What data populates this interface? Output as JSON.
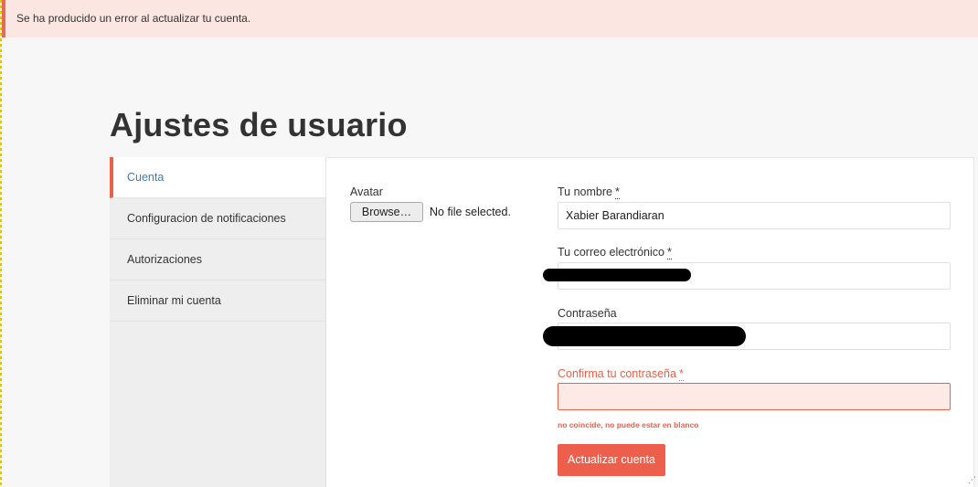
{
  "alert": {
    "message": "Se ha producido un error al actualizar tu cuenta."
  },
  "page": {
    "title": "Ajustes de usuario"
  },
  "sidebar": {
    "items": [
      {
        "label": "Cuenta",
        "active": true
      },
      {
        "label": "Configuracion de notificaciones",
        "active": false
      },
      {
        "label": "Autorizaciones",
        "active": false
      },
      {
        "label": "Eliminar mi cuenta",
        "active": false
      }
    ]
  },
  "form": {
    "avatar": {
      "label": "Avatar",
      "button_label": "Browse…",
      "status": "No file selected."
    },
    "name": {
      "label": "Tu nombre",
      "required_mark": "*",
      "value": "Xabier Barandiaran"
    },
    "email": {
      "label": "Tu correo electrónico",
      "required_mark": "*",
      "value": ""
    },
    "password": {
      "label": "Contraseña",
      "value": ""
    },
    "confirm_password": {
      "label": "Confirma tu contraseña",
      "required_mark": "*",
      "value": "",
      "error": "no coincide, no puede estar en blanco"
    },
    "submit_label": "Actualizar cuenta"
  },
  "colors": {
    "accent": "#ee5f4b",
    "alert_bg": "#fbe6e2",
    "link": "#3b7fa8"
  }
}
